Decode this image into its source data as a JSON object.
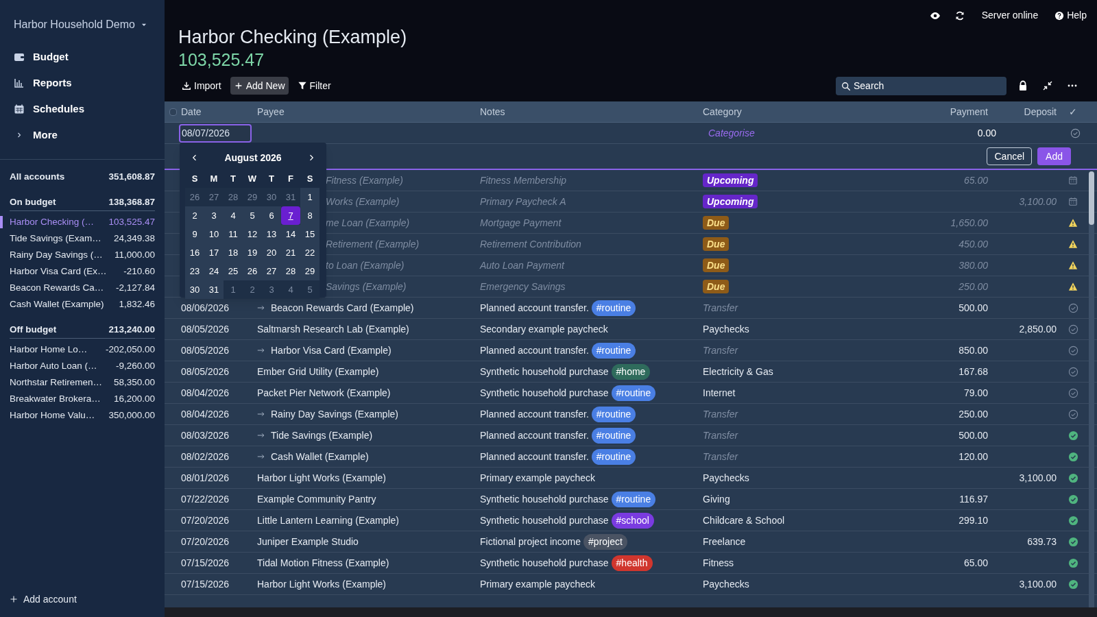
{
  "sidebar": {
    "budget_name": "Harbor Household Demo",
    "nav": [
      {
        "label": "Budget",
        "kind": "wallet"
      },
      {
        "label": "Reports",
        "kind": "chart"
      },
      {
        "label": "Schedules",
        "kind": "calendar"
      },
      {
        "label": "More",
        "kind": "chevron"
      }
    ],
    "all_accounts": {
      "label": "All accounts",
      "balance": "351,608.87"
    },
    "groups": [
      {
        "label": "On budget",
        "balance": "138,368.87",
        "accounts": [
          {
            "name": "Harbor Checking (…",
            "balance": "103,525.47",
            "selected": true
          },
          {
            "name": "Tide Savings (Exam…",
            "balance": "24,349.38",
            "selected": false
          },
          {
            "name": "Rainy Day Savings (…",
            "balance": "11,000.00",
            "selected": false
          },
          {
            "name": "Harbor Visa Card (Ex…",
            "balance": "-210.60",
            "selected": false
          },
          {
            "name": "Beacon Rewards Ca…",
            "balance": "-2,127.84",
            "selected": false
          },
          {
            "name": "Cash Wallet (Example)",
            "balance": "1,832.46",
            "selected": false
          }
        ]
      },
      {
        "label": "Off budget",
        "balance": "213,240.00",
        "accounts": [
          {
            "name": "Harbor Home Lo…",
            "balance": "-202,050.00",
            "selected": false
          },
          {
            "name": "Harbor Auto Loan (…",
            "balance": "-9,260.00",
            "selected": false
          },
          {
            "name": "Northstar Retiremen…",
            "balance": "58,350.00",
            "selected": false
          },
          {
            "name": "Breakwater Brokera…",
            "balance": "16,200.00",
            "selected": false
          },
          {
            "name": "Harbor Home Valu…",
            "balance": "350,000.00",
            "selected": false
          }
        ]
      }
    ],
    "add_account": "Add account"
  },
  "top_bar": {
    "status": "Server online",
    "help": "Help"
  },
  "header": {
    "title": "Harbor Checking (Example)",
    "balance": "103,525.47"
  },
  "toolbar": {
    "buttons": [
      {
        "label": "Import",
        "kind": "import",
        "selected": false
      },
      {
        "label": "Add New",
        "kind": "add",
        "selected": true
      },
      {
        "label": "Filter",
        "kind": "filter",
        "selected": false
      }
    ],
    "search": {
      "placeholder": "Search"
    }
  },
  "table": {
    "select_all_checked": false,
    "columns": [
      "Date",
      "Payee",
      "Notes",
      "Category",
      "Payment",
      "Deposit",
      "✓"
    ],
    "new_row": {
      "date": "08/07/2026",
      "category_placeholder": "Categorise",
      "payment": "0.00"
    },
    "actions": [
      "Cancel",
      "Add"
    ],
    "rows": [
      {
        "kind": "schedule",
        "payee": "Fitness (Example)",
        "notes": "Fitness Membership",
        "badge": {
          "text": "Upcoming",
          "kind": "upcoming"
        },
        "payment": "65.00",
        "due": false
      },
      {
        "kind": "schedule",
        "payee": "Works (Example)",
        "notes": "Primary Paycheck A",
        "badge": {
          "text": "Upcoming",
          "kind": "upcoming"
        },
        "deposit": "3,100.00",
        "due": false
      },
      {
        "kind": "schedule",
        "payee": "me Loan (Example)",
        "notes": "Mortgage Payment",
        "badge": {
          "text": "Due",
          "kind": "due"
        },
        "payment": "1,650.00",
        "due": true
      },
      {
        "kind": "schedule",
        "payee": "Retirement (Example)",
        "notes": "Retirement Contribution",
        "badge": {
          "text": "Due",
          "kind": "due"
        },
        "payment": "450.00",
        "due": true
      },
      {
        "kind": "schedule",
        "payee": "to Loan (Example)",
        "notes": "Auto Loan Payment",
        "badge": {
          "text": "Due",
          "kind": "due"
        },
        "payment": "380.00",
        "due": true
      },
      {
        "kind": "schedule",
        "payee": "Savings (Example)",
        "notes": "Emergency Savings",
        "badge": {
          "text": "Due",
          "kind": "due"
        },
        "payment": "250.00",
        "due": true
      },
      {
        "kind": "transaction",
        "date": "08/06/2026",
        "payee": "Beacon Rewards Card (Example)",
        "transfer": true,
        "notes": "Planned account transfer.",
        "tag": {
          "text": "#routine",
          "color": "#4a7fe4"
        },
        "category": "Transfer",
        "payment": "500.00",
        "reconciled": false
      },
      {
        "kind": "transaction",
        "date": "08/05/2026",
        "payee": "Saltmarsh Research Lab (Example)",
        "transfer": false,
        "notes": "Secondary example paycheck",
        "category": "Paychecks",
        "deposit": "2,850.00",
        "reconciled": false
      },
      {
        "kind": "transaction",
        "date": "08/05/2026",
        "payee": "Harbor Visa Card (Example)",
        "transfer": true,
        "notes": "Planned account transfer.",
        "tag": {
          "text": "#routine",
          "color": "#4a7fe4"
        },
        "category": "Transfer",
        "payment": "850.00",
        "reconciled": false
      },
      {
        "kind": "transaction",
        "date": "08/05/2026",
        "payee": "Ember Grid Utility (Example)",
        "transfer": false,
        "notes": "Synthetic household purchase",
        "tag": {
          "text": "#home",
          "color": "#2f6b5c"
        },
        "category": "Electricity & Gas",
        "payment": "167.68",
        "reconciled": false
      },
      {
        "kind": "transaction",
        "date": "08/04/2026",
        "payee": "Packet Pier Network (Example)",
        "transfer": false,
        "notes": "Synthetic household purchase",
        "tag": {
          "text": "#routine",
          "color": "#4a7fe4"
        },
        "category": "Internet",
        "payment": "79.00",
        "reconciled": false
      },
      {
        "kind": "transaction",
        "date": "08/04/2026",
        "payee": "Rainy Day Savings (Example)",
        "transfer": true,
        "notes": "Planned account transfer.",
        "tag": {
          "text": "#routine",
          "color": "#4a7fe4"
        },
        "category": "Transfer",
        "payment": "250.00",
        "reconciled": false
      },
      {
        "kind": "transaction",
        "date": "08/03/2026",
        "payee": "Tide Savings (Example)",
        "transfer": true,
        "notes": "Planned account transfer.",
        "tag": {
          "text": "#routine",
          "color": "#4a7fe4"
        },
        "category": "Transfer",
        "payment": "500.00",
        "reconciled": true
      },
      {
        "kind": "transaction",
        "date": "08/02/2026",
        "payee": "Cash Wallet (Example)",
        "transfer": true,
        "notes": "Planned account transfer.",
        "tag": {
          "text": "#routine",
          "color": "#4a7fe4"
        },
        "category": "Transfer",
        "payment": "120.00",
        "reconciled": true
      },
      {
        "kind": "transaction",
        "date": "08/01/2026",
        "payee": "Harbor Light Works (Example)",
        "transfer": false,
        "notes": "Primary example paycheck",
        "category": "Paychecks",
        "deposit": "3,100.00",
        "reconciled": true
      },
      {
        "kind": "transaction",
        "date": "07/22/2026",
        "payee": "Example Community Pantry",
        "transfer": false,
        "notes": "Synthetic household purchase",
        "tag": {
          "text": "#routine",
          "color": "#4a7fe4"
        },
        "category": "Giving",
        "payment": "116.97",
        "reconciled": true
      },
      {
        "kind": "transaction",
        "date": "07/20/2026",
        "payee": "Little Lantern Learning (Example)",
        "transfer": false,
        "notes": "Synthetic household purchase",
        "tag": {
          "text": "#school",
          "color": "#7a3be0"
        },
        "category": "Childcare & School",
        "payment": "299.10",
        "reconciled": true
      },
      {
        "kind": "transaction",
        "date": "07/20/2026",
        "payee": "Juniper Example Studio",
        "transfer": false,
        "notes": "Fictional project income",
        "tag": {
          "text": "#project",
          "color": "#4a5363"
        },
        "category": "Freelance",
        "deposit": "639.73",
        "reconciled": true
      },
      {
        "kind": "transaction",
        "date": "07/15/2026",
        "payee": "Tidal Motion Fitness (Example)",
        "transfer": false,
        "notes": "Synthetic household purchase",
        "tag": {
          "text": "#health",
          "color": "#d0362e"
        },
        "category": "Fitness",
        "payment": "65.00",
        "reconciled": true
      },
      {
        "kind": "transaction",
        "date": "07/15/2026",
        "payee": "Harbor Light Works (Example)",
        "transfer": false,
        "notes": "Primary example paycheck",
        "category": "Paychecks",
        "deposit": "3,100.00",
        "reconciled": true
      }
    ]
  },
  "calendar": {
    "month": "August 2026",
    "weekdays": [
      "S",
      "M",
      "T",
      "W",
      "T",
      "F",
      "S"
    ],
    "weeks": [
      [
        {
          "day": "26",
          "outside": true,
          "selected": false
        },
        {
          "day": "27",
          "outside": true,
          "selected": false
        },
        {
          "day": "28",
          "outside": true,
          "selected": false
        },
        {
          "day": "29",
          "outside": true,
          "selected": false
        },
        {
          "day": "30",
          "outside": true,
          "selected": false
        },
        {
          "day": "31",
          "outside": true,
          "selected": false
        },
        {
          "day": "1",
          "outside": false,
          "selected": false
        }
      ],
      [
        {
          "day": "2",
          "outside": false,
          "selected": false
        },
        {
          "day": "3",
          "outside": false,
          "selected": false
        },
        {
          "day": "4",
          "outside": false,
          "selected": false
        },
        {
          "day": "5",
          "outside": false,
          "selected": false
        },
        {
          "day": "6",
          "outside": false,
          "selected": false
        },
        {
          "day": "7",
          "outside": false,
          "selected": true
        },
        {
          "day": "8",
          "outside": false,
          "selected": false
        }
      ],
      [
        {
          "day": "9",
          "outside": false,
          "selected": false
        },
        {
          "day": "10",
          "outside": false,
          "selected": false
        },
        {
          "day": "11",
          "outside": false,
          "selected": false
        },
        {
          "day": "12",
          "outside": false,
          "selected": false
        },
        {
          "day": "13",
          "outside": false,
          "selected": false
        },
        {
          "day": "14",
          "outside": false,
          "selected": false
        },
        {
          "day": "15",
          "outside": false,
          "selected": false
        }
      ],
      [
        {
          "day": "16",
          "outside": false,
          "selected": false
        },
        {
          "day": "17",
          "outside": false,
          "selected": false
        },
        {
          "day": "18",
          "outside": false,
          "selected": false
        },
        {
          "day": "19",
          "outside": false,
          "selected": false
        },
        {
          "day": "20",
          "outside": false,
          "selected": false
        },
        {
          "day": "21",
          "outside": false,
          "selected": false
        },
        {
          "day": "22",
          "outside": false,
          "selected": false
        }
      ],
      [
        {
          "day": "23",
          "outside": false,
          "selected": false
        },
        {
          "day": "24",
          "outside": false,
          "selected": false
        },
        {
          "day": "25",
          "outside": false,
          "selected": false
        },
        {
          "day": "26",
          "outside": false,
          "selected": false
        },
        {
          "day": "27",
          "outside": false,
          "selected": false
        },
        {
          "day": "28",
          "outside": false,
          "selected": false
        },
        {
          "day": "29",
          "outside": false,
          "selected": false
        }
      ],
      [
        {
          "day": "30",
          "outside": false,
          "selected": false
        },
        {
          "day": "31",
          "outside": false,
          "selected": false
        },
        {
          "day": "1",
          "outside": true,
          "selected": false
        },
        {
          "day": "2",
          "outside": true,
          "selected": false
        },
        {
          "day": "3",
          "outside": true,
          "selected": false
        },
        {
          "day": "4",
          "outside": true,
          "selected": false
        },
        {
          "day": "5",
          "outside": true,
          "selected": false
        }
      ]
    ]
  }
}
